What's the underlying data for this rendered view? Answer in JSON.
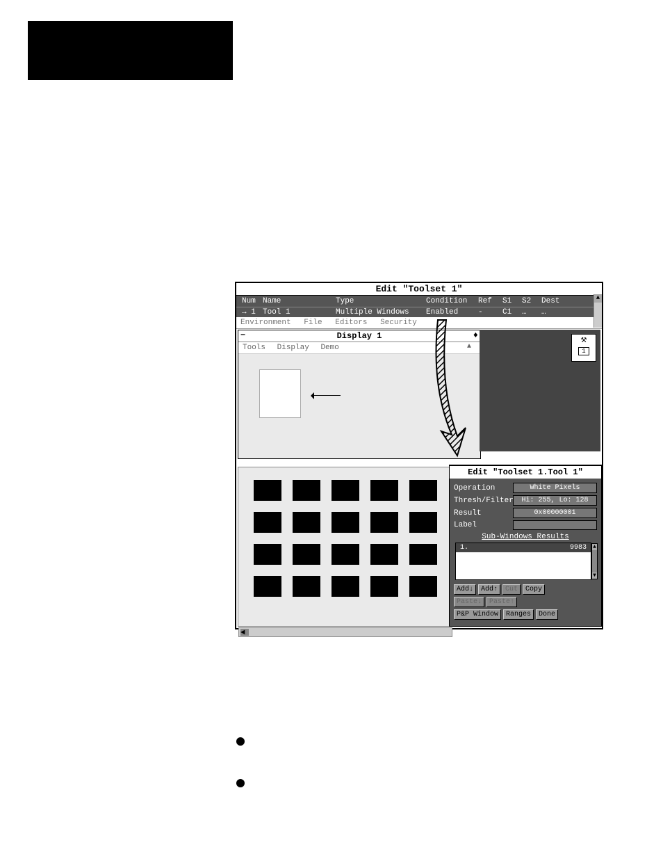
{
  "app": {
    "title": "Edit \"Toolset 1\"",
    "columns": {
      "num": "Num",
      "name": "Name",
      "type": "Type",
      "condition": "Condition",
      "ref": "Ref",
      "s1": "S1",
      "s2": "S2",
      "dest": "Dest"
    },
    "row": {
      "marker": "→",
      "num": "1",
      "name": "Tool 1",
      "type": "Multiple Windows",
      "condition": "Enabled",
      "ref": "-",
      "s1": "C1",
      "s2": "…",
      "dest": "…"
    },
    "innerMenu": {
      "env": "Environment",
      "file": "File",
      "editors": "Editors",
      "security": "Security"
    }
  },
  "display": {
    "title": "Display 1",
    "ctlMinus": "−",
    "ctlDiamond": "♦",
    "scrollUp": "▲",
    "menu": {
      "tools": "Tools",
      "display": "Display",
      "demo": "Demo"
    }
  },
  "toolsetIcon": {
    "glyph": "⚒",
    "num": "1"
  },
  "toolEditor": {
    "title": "Edit \"Toolset 1.Tool 1\"",
    "operation": {
      "label": "Operation",
      "value": "White Pixels"
    },
    "thresh": {
      "label": "Thresh/Filter",
      "value": "Hi: 255, Lo: 128"
    },
    "result": {
      "label": "Result",
      "value": "0x00000001"
    },
    "label_row": {
      "label": "Label",
      "value": ""
    },
    "subHeader": "Sub-Windows Results",
    "subRow": {
      "idx": "1.",
      "val": "9983"
    },
    "subScroll": {
      "up": "▲",
      "down": "▼"
    },
    "buttons": {
      "addDown": "Add↓",
      "addUp": "Add↑",
      "cut": "Cut",
      "copy": "Copy",
      "pasteDown": "Paste↓",
      "pasteUp": "Paste↑",
      "pfw": "P&P Window",
      "ranges": "Ranges",
      "done": "Done"
    }
  },
  "hscroll": {
    "left": "◄"
  }
}
